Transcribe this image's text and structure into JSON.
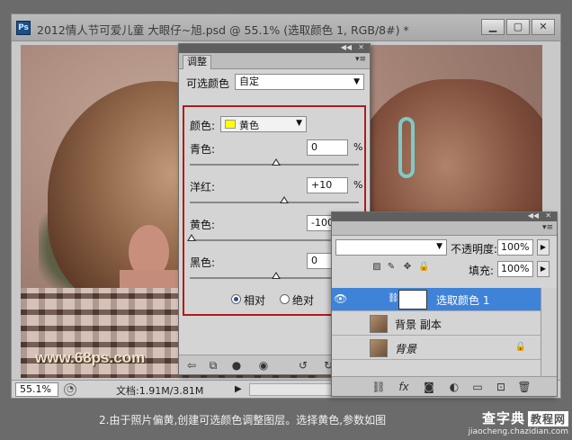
{
  "document": {
    "title": "2012情人节可爱儿童  大眼仔~旭.psd @ 55.1% (选取颜色 1, RGB/8#) *",
    "logo": "Ps",
    "watermark": "www.68ps.com",
    "zoom": "55.1%",
    "docsize": "文档:1.91M/3.81M",
    "window_buttons": [
      "minimize-icon",
      "maximize-icon",
      "close-icon"
    ]
  },
  "adjustments": {
    "tab": "调整",
    "preset_label": "可选颜色",
    "preset_value": "自定",
    "color_label": "颜色:",
    "color_value": "黄色",
    "color_swatch": "#ffff00",
    "sliders": [
      {
        "label": "青色:",
        "value": "0",
        "unit": "%",
        "level": 0
      },
      {
        "label": "洋红:",
        "value": "+10",
        "unit": "%",
        "level": 10
      },
      {
        "label": "黄色:",
        "value": "-100",
        "unit": "%",
        "level": -100
      },
      {
        "label": "黑色:",
        "value": "0",
        "unit": "%",
        "level": 0
      }
    ],
    "method_relative": "相对",
    "method_absolute": "绝对",
    "method_selected": "relative"
  },
  "layers": {
    "opacity_label": "不透明度:",
    "opacity_value": "100%",
    "fill_label": "填充:",
    "fill_value": "100%",
    "items": [
      {
        "name": "选取颜色 1",
        "selected": true
      },
      {
        "name": "背景 副本",
        "selected": false
      },
      {
        "name": "背景",
        "selected": false,
        "locked": true
      }
    ]
  },
  "caption": "2.由于照片偏黄,创建可选颜色调整图层。选择黄色,参数如图",
  "site": {
    "name": "查字典",
    "box": "教程网",
    "url": "jiaocheng.chazidian.com"
  }
}
